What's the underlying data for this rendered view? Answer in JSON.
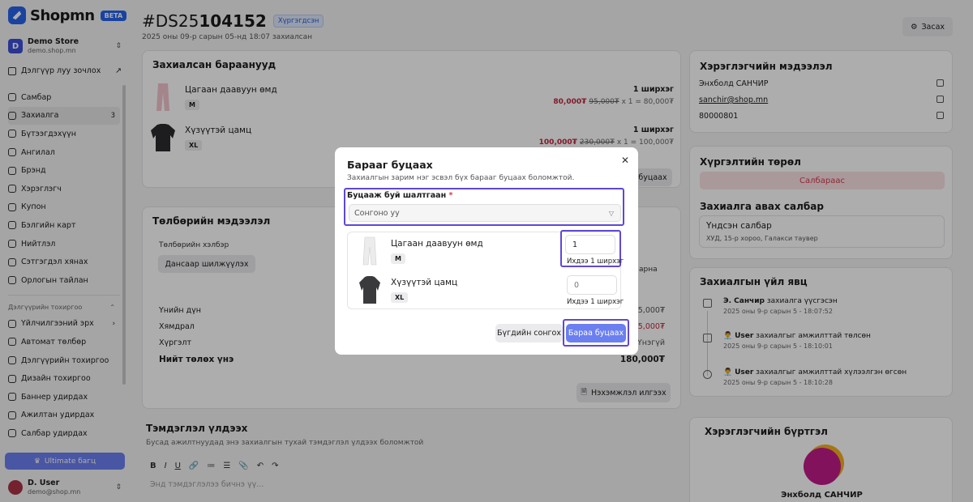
{
  "brand": {
    "name": "Shopmn",
    "badge": "BETA"
  },
  "store": {
    "name": "Demo Store",
    "domain": "demo.shop.mn"
  },
  "visit_store": "Дэлгүүр луу зочлох",
  "nav": [
    {
      "label": "Самбар",
      "icon": "dashboard-icon"
    },
    {
      "label": "Захиалга",
      "icon": "order-icon",
      "badge": "3"
    },
    {
      "label": "Бүтээгдэхүүн",
      "icon": "product-icon"
    },
    {
      "label": "Ангилал",
      "icon": "category-icon"
    },
    {
      "label": "Брэнд",
      "icon": "brand-icon"
    },
    {
      "label": "Хэрэглэгч",
      "icon": "user-icon"
    },
    {
      "label": "Купон",
      "icon": "coupon-icon"
    },
    {
      "label": "Бэлгийн карт",
      "icon": "gift-card-icon"
    },
    {
      "label": "Нийтлэл",
      "icon": "article-icon"
    },
    {
      "label": "Сэтгэгдэл хянах",
      "icon": "review-icon"
    },
    {
      "label": "Орлогын тайлан",
      "icon": "report-icon"
    }
  ],
  "settings_group": "Дэлгүүрийн тохиргоо",
  "settings_nav": [
    {
      "label": "Үйлчилгээний эрх",
      "icon": "service-icon"
    },
    {
      "label": "Автомат төлбөр",
      "icon": "auto-pay-icon"
    },
    {
      "label": "Дэлгүүрийн тохиргоо",
      "icon": "store-settings-icon"
    },
    {
      "label": "Дизайн тохиргоо",
      "icon": "design-icon"
    },
    {
      "label": "Баннер удирдах",
      "icon": "banner-icon"
    },
    {
      "label": "Ажилтан удирдах",
      "icon": "staff-icon"
    },
    {
      "label": "Салбар удирдах",
      "icon": "branch-icon"
    }
  ],
  "ultimate": "Ultimate багц",
  "user": {
    "name": "D. User",
    "email": "demo@shop.mn"
  },
  "order": {
    "id_prefix": "#DS25",
    "id_suffix": "104152",
    "status": "Хүргэгдсэн",
    "date": "2025 оны 09-р сарын 05-нд 18:07 захиалсан",
    "edit": "Засах"
  },
  "ordered_items": {
    "title": "Захиалсан бараанууд",
    "items": [
      {
        "name": "Цагаан даавуун өмд",
        "size": "M",
        "qty": "1 ширхэг",
        "price": "80,000₮",
        "old_price": "95,000₮",
        "calc": "x 1 = 80,000₮"
      },
      {
        "name": "Хүзүүтэй цамц",
        "size": "XL",
        "qty": "1 ширхэг",
        "price": "100,000₮",
        "old_price": "230,000₮",
        "calc": "x 1 = 100,000₮"
      }
    ],
    "return_btn_partial": "буцаах"
  },
  "payment": {
    "title": "Төлбөрийн мэдээлэл",
    "method_label": "Төлбөрийн хэлбэр",
    "method": "Дансаар шилжүүлэх",
    "side_partial": "арна",
    "rows": [
      {
        "label": "Үнийн дүн",
        "value": "5,000₮"
      },
      {
        "label": "Хямдрал",
        "value": "5,000₮"
      },
      {
        "label": "Хүргэлт",
        "value": "Үнэгүй"
      }
    ],
    "total_label": "Нийт төлөх үнэ",
    "total": "180,000₮",
    "send_invoice": "Нэхэмжлэл илгээх"
  },
  "notes": {
    "title": "Тэмдэглэл үлдээх",
    "subtitle": "Бусад ажилтнуудад энэ захиалгын тухай тэмдэглэл үлдээх боломжтой",
    "toolbar": [
      "B",
      "I",
      "U",
      "🔗",
      "≔",
      "☰",
      "📎",
      "↶",
      "↷"
    ],
    "placeholder": "Энд тэмдэглэлээ бичнэ үү..."
  },
  "customer": {
    "title": "Хэрэглэгчийн мэдээлэл",
    "name": "Энхболд САНЧИР",
    "email": "sanchir@shop.mn",
    "phone": "80000801"
  },
  "delivery": {
    "title": "Хүргэлтийн төрөл",
    "type": "Салбараас",
    "branch_title": "Захиалга авах салбар",
    "branch_name": "Үндсэн салбар",
    "branch_addr": "ХУД, 15-р хороо, Галакси таувер"
  },
  "timeline": {
    "title": "Захиалгын үйл явц",
    "events": [
      {
        "actor": "Э. Санчир",
        "text": "захиалга үүсгэсэн",
        "time": "2025 оны 9-р сарын 5 - 18:07:52"
      },
      {
        "actor": "User",
        "text": "захиалгыг амжилттай төлсөн",
        "time": "2025 оны 9-р сарын 5 - 18:10:01"
      },
      {
        "actor": "User",
        "text": "захиалгыг амжилттай хүлээлгэн өгсөн",
        "time": "2025 оны 9-р сарын 5 - 18:10:28"
      }
    ]
  },
  "customer_card": {
    "title": "Хэрэглэгчийн бүртгэл",
    "name": "Энхболд САНЧИР"
  },
  "modal": {
    "title": "Барааг буцаах",
    "subtitle": "Захиалгын зарим нэг эсвэл бүх барааг буцаах боломжтой.",
    "reason_label": "Буцааж буй шалтгаан",
    "required": "*",
    "reason_placeholder": "Сонгоно уу",
    "items": [
      {
        "name": "Цагаан даавуун өмд",
        "size": "M",
        "qty": "1",
        "max": "Ихдээ 1 ширхэг"
      },
      {
        "name": "Хүзүүтэй цамц",
        "size": "XL",
        "qty_placeholder": "0",
        "max": "Ихдээ 1 ширхэг"
      }
    ],
    "select_all": "Бүгдийн сонгох",
    "return_btn": "Бараа буцаах"
  },
  "colors": {
    "accent": "#6b7ff0",
    "highlight": "#6047d8",
    "danger": "#c0283f",
    "brand": "#2563eb"
  }
}
